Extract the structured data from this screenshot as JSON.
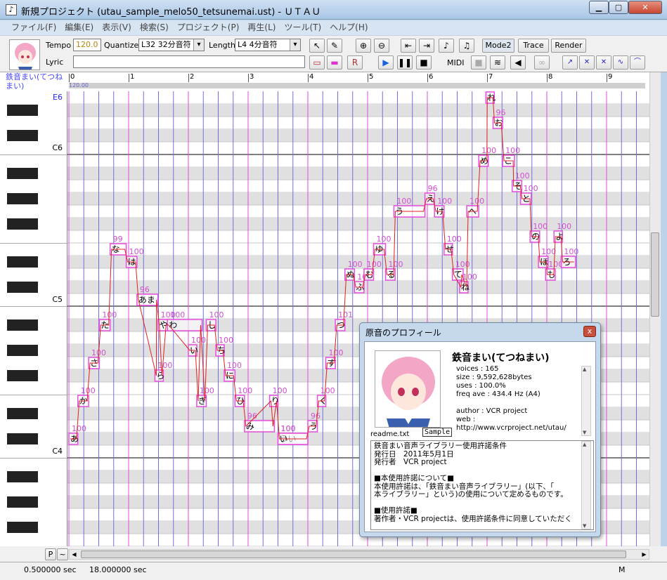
{
  "window": {
    "title": "新規プロジェクト (utau_sample_melo50_tetsunemai.ust) - ＵＴＡＵ",
    "minimize": "▁",
    "maximize": "▢",
    "close": "✕"
  },
  "menu": [
    "ファイル(F)",
    "編集(E)",
    "表示(V)",
    "検索(S)",
    "プロジェクト(P)",
    "再生(L)",
    "ツール(T)",
    "ヘルプ(H)"
  ],
  "toolbar": {
    "tempo_label": "Tempo",
    "tempo_value": "120.0",
    "quantize_label": "Quantize",
    "quantize_value": "L32 32分音符",
    "length_label": "Length",
    "length_value": "L4  4分音符",
    "lyric_label": "Lyric",
    "lyric_value": "",
    "midi_label": "MIDI",
    "mode2_label": "Mode2",
    "trace_label": "Trace",
    "render_label": "Render"
  },
  "voice": {
    "name": "鉄音まい(てつねまい)"
  },
  "ruler": {
    "bars": [
      "0",
      "1",
      "2",
      "3",
      "4",
      "5",
      "6",
      "7",
      "8",
      "9"
    ],
    "tempo_marker": "120.00"
  },
  "keyboard": {
    "labels": [
      {
        "text": "E6",
        "color": "#22f"
      },
      {
        "text": "C6",
        "color": "#000"
      },
      {
        "text": "C5",
        "color": "#000"
      },
      {
        "text": "C4",
        "color": "#000"
      }
    ]
  },
  "notes": [
    {
      "lyric": "あ",
      "value": "100",
      "start": 0,
      "len": 0.15,
      "key": 8
    },
    {
      "lyric": "か",
      "value": "100",
      "start": 0.15,
      "len": 0.18,
      "key": 11
    },
    {
      "lyric": "さ",
      "value": "100",
      "start": 0.33,
      "len": 0.18,
      "key": 14
    },
    {
      "lyric": "た",
      "value": "100",
      "start": 0.51,
      "len": 0.18,
      "key": 17
    },
    {
      "lyric": "な",
      "value": "99",
      "start": 0.69,
      "len": 0.27,
      "key": 23
    },
    {
      "lyric": "は",
      "value": "100",
      "start": 0.96,
      "len": 0.18,
      "key": 22
    },
    {
      "lyric": "あま",
      "value": "96",
      "start": 1.14,
      "len": 0.35,
      "key": 19
    },
    {
      "lyric": "や",
      "value": "100",
      "start": 1.49,
      "len": 0.16,
      "key": 17
    },
    {
      "lyric": "わ",
      "value": "100",
      "start": 1.65,
      "len": 0.58,
      "key": 17
    },
    {
      "lyric": "ら",
      "value": "100",
      "start": 1.44,
      "len": 0.14,
      "key": 13
    },
    {
      "lyric": "い",
      "value": "100",
      "start": 2.0,
      "len": 0.14,
      "key": 15
    },
    {
      "lyric": "ぎ",
      "value": "100",
      "start": 2.14,
      "len": 0.16,
      "key": 11
    },
    {
      "lyric": "し",
      "value": "100",
      "start": 2.3,
      "len": 0.16,
      "key": 17
    },
    {
      "lyric": "ち",
      "value": "100",
      "start": 2.46,
      "len": 0.14,
      "key": 15
    },
    {
      "lyric": "に",
      "value": "100",
      "start": 2.6,
      "len": 0.18,
      "key": 13
    },
    {
      "lyric": "ひ",
      "value": "100",
      "start": 2.78,
      "len": 0.16,
      "key": 11
    },
    {
      "lyric": "み",
      "value": "96",
      "start": 2.94,
      "len": 0.5,
      "key": 9
    },
    {
      "lyric": "り",
      "value": "100",
      "start": 3.36,
      "len": 0.14,
      "key": 11
    },
    {
      "lyric": "うい",
      "value": "100",
      "start": 3.5,
      "len": 0.5,
      "key": 8
    },
    {
      "lyric": "い",
      "value": "100",
      "start": 3.5,
      "len": 0.5,
      "key": 8
    },
    {
      "lyric": "う",
      "value": "96",
      "start": 4.0,
      "len": 0.16,
      "key": 9
    },
    {
      "lyric": "く",
      "value": "100",
      "start": 4.16,
      "len": 0.14,
      "key": 11
    },
    {
      "lyric": "す",
      "value": "100",
      "start": 4.3,
      "len": 0.16,
      "key": 14
    },
    {
      "lyric": "つ",
      "value": "101",
      "start": 4.46,
      "len": 0.16,
      "key": 17
    },
    {
      "lyric": "ぬ",
      "value": "100",
      "start": 4.62,
      "len": 0.16,
      "key": 21
    },
    {
      "lyric": "ふ",
      "value": "100",
      "start": 4.78,
      "len": 0.16,
      "key": 20
    },
    {
      "lyric": "む",
      "value": "100",
      "start": 4.94,
      "len": 0.16,
      "key": 21
    },
    {
      "lyric": "ゆ",
      "value": "100",
      "start": 5.1,
      "len": 0.2,
      "key": 23
    },
    {
      "lyric": "る",
      "value": "100",
      "start": 5.3,
      "len": 0.16,
      "key": 21
    },
    {
      "lyric": "う",
      "value": "100",
      "start": 5.44,
      "len": 0.52,
      "key": 26
    },
    {
      "lyric": "え",
      "value": "96",
      "start": 5.96,
      "len": 0.16,
      "key": 27
    },
    {
      "lyric": "け",
      "value": "100",
      "start": 6.12,
      "len": 0.16,
      "key": 26
    },
    {
      "lyric": "せ",
      "value": "100",
      "start": 6.28,
      "len": 0.14,
      "key": 23
    },
    {
      "lyric": "て",
      "value": "100",
      "start": 6.42,
      "len": 0.18,
      "key": 21
    },
    {
      "lyric": "ね",
      "value": "100",
      "start": 6.54,
      "len": 0.14,
      "key": 20
    },
    {
      "lyric": "へ",
      "value": "100",
      "start": 6.66,
      "len": 0.2,
      "key": 26
    },
    {
      "lyric": "め",
      "value": "100",
      "start": 6.86,
      "len": 0.16,
      "key": 30
    },
    {
      "lyric": "れ",
      "value": "100",
      "start": 6.98,
      "len": 0.14,
      "key": 35
    },
    {
      "lyric": "お",
      "value": "96",
      "start": 7.1,
      "len": 0.16,
      "key": 33
    },
    {
      "lyric": "こ",
      "value": "100",
      "start": 7.26,
      "len": 0.2,
      "key": 30
    },
    {
      "lyric": "そ",
      "value": "100",
      "start": 7.42,
      "len": 0.16,
      "key": 28
    },
    {
      "lyric": "と",
      "value": "100",
      "start": 7.56,
      "len": 0.18,
      "key": 27
    },
    {
      "lyric": "の",
      "value": "100",
      "start": 7.72,
      "len": 0.16,
      "key": 24
    },
    {
      "lyric": "ほ",
      "value": "100",
      "start": 7.86,
      "len": 0.16,
      "key": 22
    },
    {
      "lyric": "も",
      "value": "100",
      "start": 7.98,
      "len": 0.16,
      "key": 21
    },
    {
      "lyric": "よ",
      "value": "100",
      "start": 8.12,
      "len": 0.14,
      "key": 24
    },
    {
      "lyric": "ろ",
      "value": "100",
      "start": 8.24,
      "len": 0.24,
      "key": 22
    }
  ],
  "dialog": {
    "title": "原音のプロフィール",
    "close": "x",
    "name": "鉄音まい(てつねまい)",
    "voices": "voices : 165",
    "size": "size : 9,592,628bytes",
    "uses": "uses : 100.0%",
    "freq": "freq ave : 434.4 Hz (A4)",
    "author": "author : VCR project",
    "web": "web :",
    "url": "http://www.vcrproject.net/utau/",
    "readme": "readme.txt",
    "sample": "Sample",
    "license": [
      "鉄音まい音声ライブラリー使用許諾条件",
      "発行日　2011年5月1日",
      "発行者　VCR project",
      "",
      "■本使用許諾について■",
      "本使用許諾は、「鉄音まい音声ライブラリー」(以下、「",
      "本ライブラリー」という)の使用について定めるものです。",
      "",
      "■使用許諾■",
      "著作者・VCR projectは、使用許諾条件に同意していただく"
    ]
  },
  "bottom": {
    "p_label": "P",
    "tilde_label": "~"
  },
  "status": {
    "time1": "0.500000 sec",
    "time2": "18.000000 sec",
    "mode": "M"
  }
}
